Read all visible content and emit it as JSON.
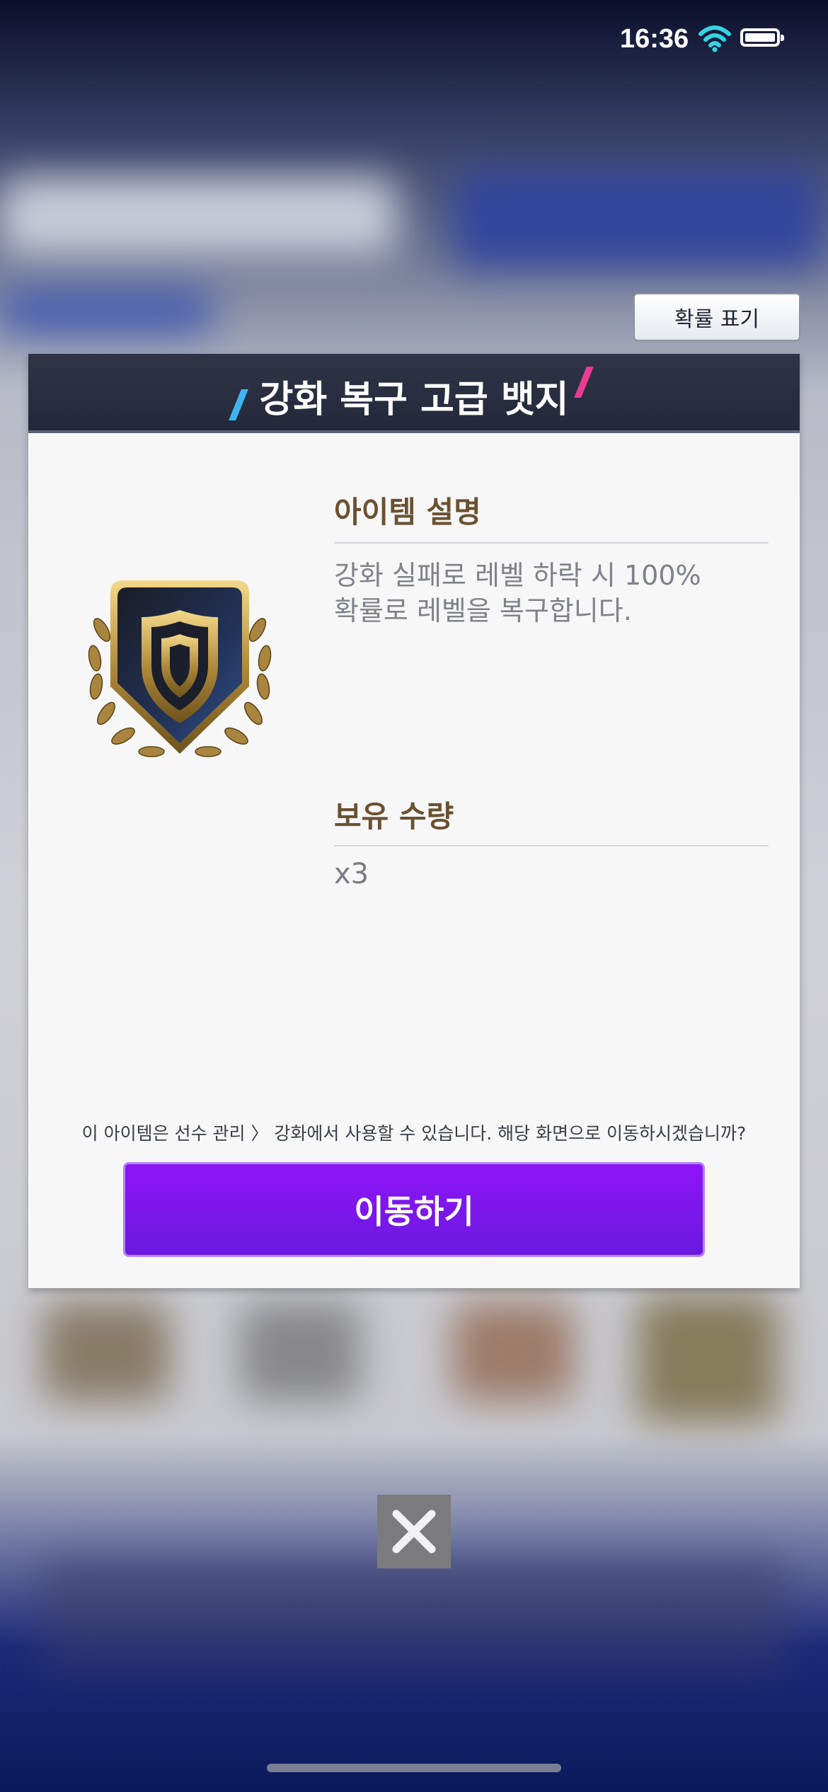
{
  "status_bar": {
    "time": "16:36",
    "icons": [
      "wifi-icon",
      "battery-icon"
    ]
  },
  "probability_button": {
    "label": "확률 표기"
  },
  "modal": {
    "title": "강화 복구 고급 뱃지",
    "badge_icon": "shield-badge-icon",
    "description_section": {
      "title": "아이템 설명",
      "text_line1": "강화 실패로 레벨 하락 시 100%",
      "text_line2": "확률로 레벨을 복구합니다."
    },
    "quantity_section": {
      "title": "보유 수량",
      "value": "x3"
    },
    "notice": "이 아이템은 선수 관리 〉 강화에서 사용할 수 있습니다. 해당 화면으로 이동하시겠습니까?",
    "go_button": {
      "label": "이동하기"
    }
  },
  "close_button": {
    "icon": "close-icon"
  },
  "colors": {
    "accent_purple": "#7e17f0",
    "header_dark": "#2a2f41",
    "section_title_brown": "#6b5131"
  }
}
